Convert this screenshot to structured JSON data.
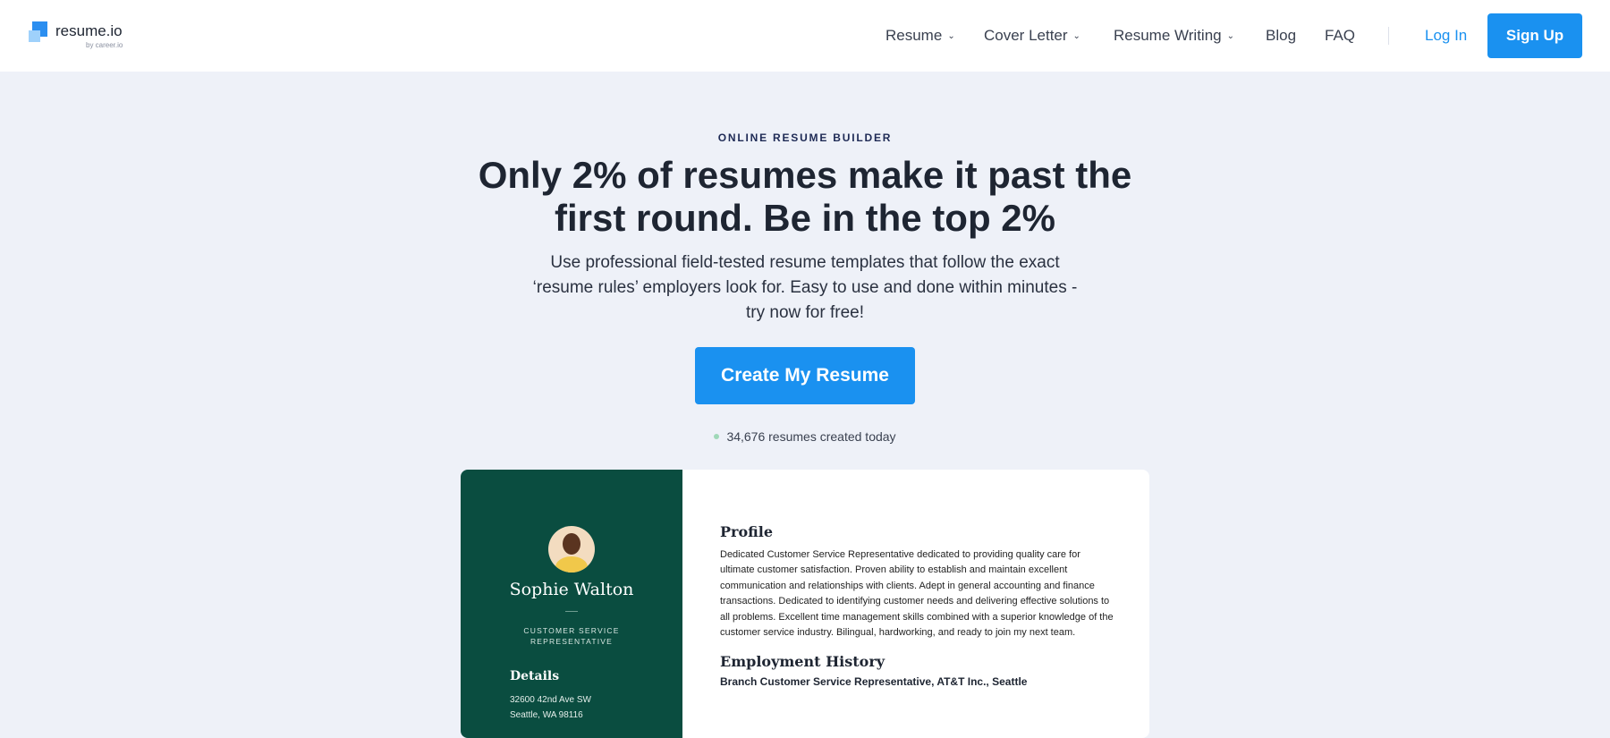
{
  "nav": {
    "logo_text": "resume.io",
    "logo_sub": "by career.io",
    "items": [
      {
        "label": "Resume",
        "dropdown": true
      },
      {
        "label": "Cover Letter",
        "dropdown": true
      },
      {
        "label": "Resume Writing",
        "dropdown": true
      },
      {
        "label": "Blog"
      },
      {
        "label": "FAQ"
      }
    ],
    "login": "Log In",
    "signup": "Sign Up",
    "chevron": "⌄"
  },
  "hero": {
    "eyebrow": "ONLINE RESUME BUILDER",
    "title_line1": "Only 2% of resumes make it past the",
    "title_line2": "first round. Be in the top 2%",
    "subtitle": "Use professional field-tested resume templates that follow the exact ‘resume rules’ employers look for. Easy to use and done within minutes - try now for free!",
    "cta": "Create My Resume",
    "counter": "34,676 resumes created today"
  },
  "resume": {
    "name": "Sophie Walton",
    "role": "CUSTOMER SERVICE REPRESENTATIVE",
    "details_heading": "Details",
    "address_line1": "32600 42nd Ave SW",
    "address_line2": "Seattle, WA 98116",
    "profile_heading": "Profile",
    "profile_text": "Dedicated Customer Service Representative dedicated to providing quality care for ultimate customer satisfaction. Proven ability to establish and maintain excellent communication and relationships with clients. Adept in general accounting and finance transactions. Dedicated to identifying customer needs and delivering effective solutions to all problems. Excellent time management skills combined with a superior knowledge of the customer service industry. Bilingual, hardworking, and ready to join my next team.",
    "employment_heading": "Employment History",
    "employment_first": "Branch Customer Service Representative, AT&T Inc., Seattle"
  },
  "colors": {
    "accent": "#1a91f0",
    "resume_sidebar": "#0a4d40",
    "background": "#eef1f8"
  }
}
